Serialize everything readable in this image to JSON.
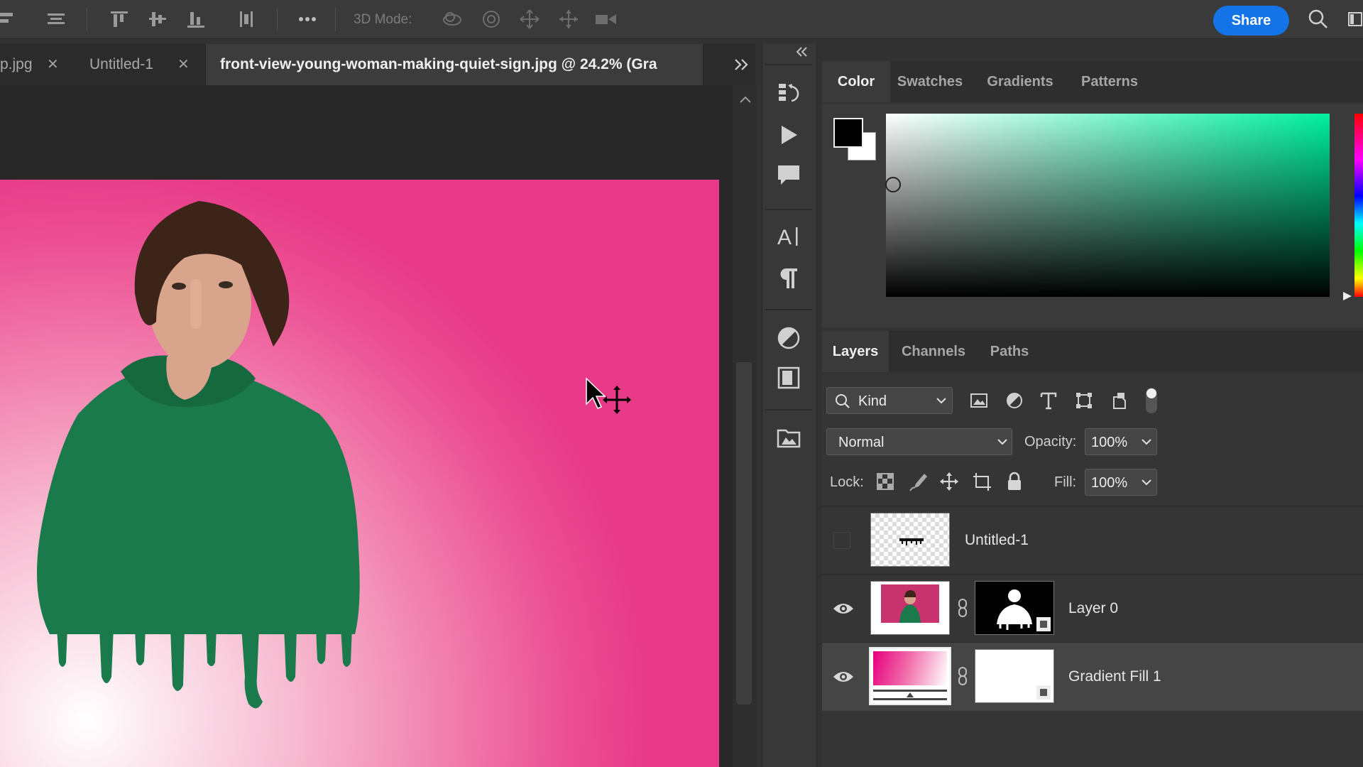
{
  "options_bar": {
    "mode_label": "3D Mode:",
    "share_label": "Share",
    "icons": [
      "align-left-icon",
      "align-horizontal-center-icon",
      "align-top-icon",
      "align-vertical-center-icon",
      "align-bottom-icon",
      "distribute-icon",
      "more-icon",
      "orbit-3d-icon",
      "roll-3d-icon",
      "drag-3d-icon",
      "slide-3d-icon",
      "scale-3d-icon",
      "search-icon",
      "workspace-icon"
    ]
  },
  "doc_tabs": [
    {
      "label": "p.jpg"
    },
    {
      "label": "Untitled-1"
    },
    {
      "label": "front-view-young-woman-making-quiet-sign.jpg @ 24.2% (Gra"
    }
  ],
  "color_panel": {
    "tabs": [
      "Color",
      "Swatches",
      "Gradients",
      "Patterns"
    ],
    "active_tab": "Color",
    "foreground": "#000000",
    "background": "#ffffff",
    "picker_hue": "#00f0a0"
  },
  "layers_panel": {
    "tabs": [
      "Layers",
      "Channels",
      "Paths"
    ],
    "active_tab": "Layers",
    "filter_kind": "Kind",
    "blend_mode": "Normal",
    "opacity_label": "Opacity:",
    "opacity_value": "100%",
    "lock_label": "Lock:",
    "fill_label": "Fill:",
    "fill_value": "100%",
    "layers": [
      {
        "name": "Untitled-1",
        "visible": false
      },
      {
        "name": "Layer 0",
        "visible": true
      },
      {
        "name": "Gradient Fill 1",
        "visible": true,
        "selected": true
      }
    ]
  },
  "colors": {
    "accent": "#1473e6",
    "gradient_pink": "#e83a88",
    "hoodie_green": "#1b7a4b"
  }
}
